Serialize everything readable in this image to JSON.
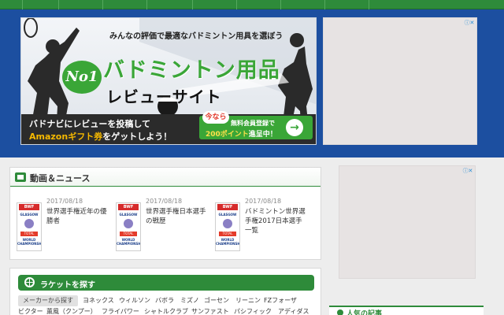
{
  "banner": {
    "tagline": "みんなの評価で最適なバドミントン用具を選ぼう",
    "badge": "No1",
    "title_line1": "バドミントン用品",
    "title_line2": "レビューサイト",
    "message_line1": "バドナビにレビューを投稿して",
    "message_line2_highlight": "Amazonギフト券",
    "message_line2_rest": "をゲットしよう！",
    "cta_now": "今なら",
    "cta_line1": "無料会員登録で",
    "cta_line2_points": "200ポイント",
    "cta_line2_rest": "進呈中！",
    "cta_arrow": "→"
  },
  "news": {
    "title": "動画＆ニュース",
    "thumb_logo": "BWF",
    "thumb_event": "GLASGOW",
    "thumb_sponsor": "TOTAL",
    "thumb_caption": "WORLD CHAMPIONSHIPS",
    "items": [
      {
        "date": "2017/08/18",
        "headline": "世界選手権近年の優勝者"
      },
      {
        "date": "2017/08/18",
        "headline": "世界選手権日本選手の戦歴"
      },
      {
        "date": "2017/08/18",
        "headline": "バドミントン世界選手権2017日本選手一覧"
      }
    ]
  },
  "racket": {
    "title": "ラケットを探す",
    "maker_tag": "メーカーから探す",
    "makers_row1": [
      "ヨネックス",
      "ウィルソン",
      "バボラ",
      "ミズノ",
      "ゴーセン",
      "リーニン",
      "FZフォーザ"
    ],
    "makers_row2": [
      "ビクター",
      "薫風（クンプー）",
      "フライパワー",
      "シャトルクラブ",
      "サンファスト",
      "パシフィック",
      "アディダス"
    ]
  },
  "ads": {
    "choice_icon": "ⓘ✕"
  },
  "sidebar": {
    "section_title": "人気の記事"
  },
  "colors": {
    "brand_green": "#2e8b3a",
    "band_blue": "#1c4fa0",
    "accent_yellow": "#f5b800"
  }
}
